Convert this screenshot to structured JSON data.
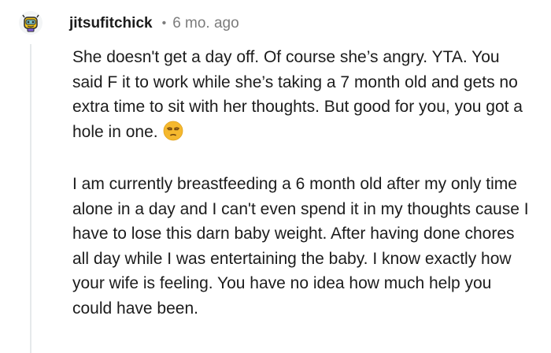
{
  "comment": {
    "username": "jitsufitchick",
    "separator": "•",
    "age": "6 mo. ago",
    "paragraphs": [
      "She doesn't get a day off. Of course she’s angry. YTA. You said F it to work while she’s taking a 7 month old and gets no extra time to sit with her thoughts. But good for you, you got a hole in one.",
      "I am currently breastfeeding a 6 month old after my only time alone in a day and I can't even spend it in my thoughts cause I have to lose this darn baby weight. After having done chores all day while I was entertaining the baby. I know exactly how your wife is feeling. You have no idea how much help you could have been."
    ],
    "emoji": "unamused-face",
    "avatar_icon": "snoo-avatar-icon"
  },
  "colors": {
    "text": "#1c1c1c",
    "meta": "#7c7c7c",
    "thread_line": "#e6e9eb",
    "emoji": "#f5b82e"
  }
}
